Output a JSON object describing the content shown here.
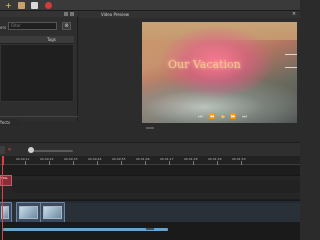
{
  "left_panel": {
    "filter_label": "Filter",
    "filter_placeholder": "Filter",
    "clear_label": "⊗",
    "tags_header": "Tags",
    "effects_tab": "Effects"
  },
  "preview": {
    "title": "Video Preview",
    "overlay_title": "Our Vacation",
    "close": "×",
    "transport": [
      "⏮",
      "⏪",
      "▶",
      "⏩",
      "⏭"
    ]
  },
  "timeline": {
    "ruler_ticks": [
      "00:00:11",
      "00:00:22",
      "00:00:33",
      "00:00:44",
      "00:00:55",
      "00:01:06",
      "00:01:17",
      "00:01:28",
      "00:01:39",
      "00:01:50"
    ],
    "track_label": "Title"
  },
  "colors": {
    "accent": "#f2c94c",
    "playhead": "#e04040",
    "progress": "#6aa2c9"
  }
}
